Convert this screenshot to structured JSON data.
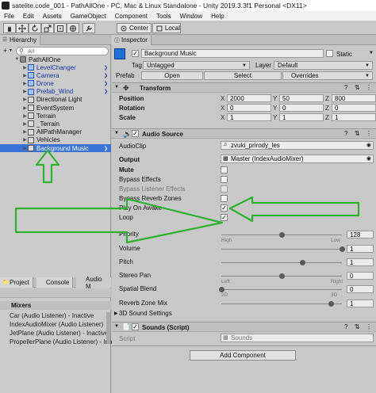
{
  "window": {
    "title": "satelite.code_001 - PathAllOne - PC, Mac & Linux Standalone - Unity 2019.3.3f1 Personal <DX11>"
  },
  "menu": [
    "File",
    "Edit",
    "Assets",
    "GameObject",
    "Component",
    "Tools",
    "Window",
    "Help"
  ],
  "toolbar": {
    "center_label": "Center",
    "local_label": "Local"
  },
  "hierarchy": {
    "tab_label": "Hierarchy",
    "add_label": "+",
    "search_placeholder": "All",
    "scene": "PathAllOne",
    "items": [
      {
        "label": "LevelChanger",
        "prefab": true
      },
      {
        "label": "Camera",
        "prefab": true
      },
      {
        "label": "Drone",
        "prefab": true
      },
      {
        "label": "Prefab_Wind",
        "prefab": true
      },
      {
        "label": "Directional Light",
        "prefab": false
      },
      {
        "label": "EventSystem",
        "prefab": false
      },
      {
        "label": "Terrain",
        "prefab": false
      },
      {
        "label": "_Terrain",
        "prefab": false
      },
      {
        "label": "AllPathManager",
        "prefab": false
      },
      {
        "label": "Vehicles",
        "prefab": false
      },
      {
        "label": "Background Music",
        "prefab": false,
        "selected": true
      }
    ]
  },
  "bottom_tabs": [
    "Project",
    "Console",
    "Audio M"
  ],
  "mixers": {
    "heading": "Mixers",
    "items": [
      "Car   (Audio Listener) - Inactive",
      "IndexAudioMixer   (Audio Listener)",
      "JetPlane   (Audio Listener) - Inactive",
      "PropellerPlane   (Audio Listener) - Inactive"
    ]
  },
  "inspector": {
    "tab_label": "Inspector",
    "object_name": "Background Music",
    "static_label": "Static",
    "tag_label": "Tag",
    "tag_value": "Untagged",
    "layer_label": "Layer",
    "layer_value": "Default",
    "prefab_label": "Prefab",
    "prefab_open": "Open",
    "prefab_select": "Select",
    "prefab_overrides": "Overrides",
    "transform": {
      "title": "Transform",
      "position_label": "Position",
      "position": [
        "2000",
        "50",
        "800"
      ],
      "rotation_label": "Rotation",
      "rotation": [
        "0",
        "0",
        "0"
      ],
      "scale_label": "Scale",
      "scale": [
        "1",
        "1",
        "1"
      ],
      "axis": [
        "X",
        "Y",
        "Z"
      ]
    },
    "audio_source": {
      "title": "Audio Source",
      "audioclip_label": "AudioClip",
      "audioclip_value": "zvuki_prirody_les",
      "output_label": "Output",
      "output_value": "Master (IndexAudioMixer)",
      "mute_label": "Mute",
      "bypass_effects_label": "Bypass Effects",
      "bypass_listener_label": "Bypass Listener Effects",
      "bypass_reverb_label": "Bypass Reverb Zones",
      "play_on_awake_label": "Play On Awake",
      "loop_label": "Loop",
      "priority_label": "Priority",
      "priority_value": "128",
      "priority_level": 0.5,
      "priority_low": "High",
      "priority_high": "Low",
      "volume_label": "Volume",
      "volume_value": "1",
      "volume_level": 1.0,
      "pitch_label": "Pitch",
      "pitch_value": "1",
      "pitch_level": 0.67,
      "stereo_label": "Stereo Pan",
      "stereo_value": "0",
      "stereo_level": 0.5,
      "stereo_left": "Left",
      "stereo_right": "Right",
      "spatial_label": "Spatial Blend",
      "spatial_value": "0",
      "spatial_level": 0.0,
      "spatial_2d": "2D",
      "spatial_3d": "3D",
      "reverb_label": "Reverb Zone Mix",
      "reverb_value": "1",
      "reverb_level": 0.91,
      "sound_settings_label": "3D Sound Settings"
    },
    "sounds_script": {
      "title": "Sounds (Script)",
      "script_label": "Script",
      "script_value": "Sounds"
    },
    "add_component_label": "Add Component"
  },
  "colors": {
    "selection": "#3a72d8",
    "arrow": "#2fb02f",
    "prefab_text": "#1438a8"
  }
}
